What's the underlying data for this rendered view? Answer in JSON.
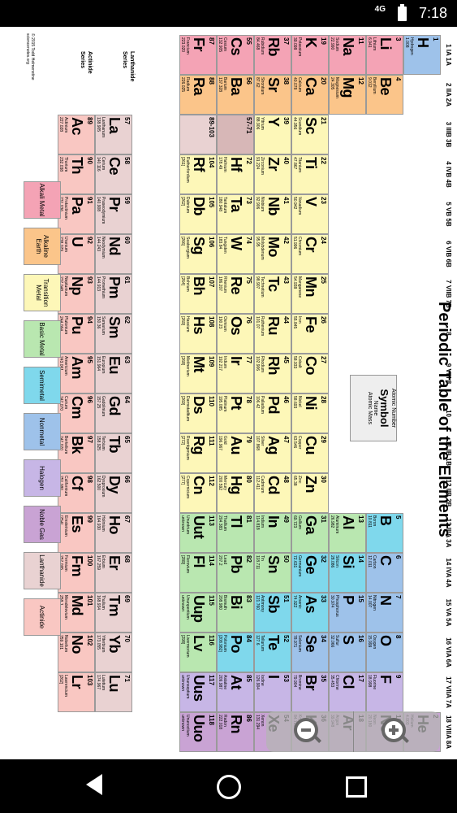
{
  "status": {
    "network": "4G",
    "time": "7:18"
  },
  "title": "Periodic Table of the Elements",
  "legend": {
    "atomic_number": "Atomic Number",
    "symbol": "Symbol",
    "name": "Name",
    "mass": "Atomic  Mass"
  },
  "series": {
    "lanthanide": "Lanthanide Series",
    "actinide": "Actinide Series"
  },
  "placeholders": {
    "la": "57-71",
    "ac": "89-103"
  },
  "copyright": "© 2015 Todd Helmenstine sciencenotes.org",
  "colors": {
    "alkali": "#f4a3b5",
    "alkaline": "#fbc58a",
    "transition": "#fdf7b8",
    "basic": "#b9e7b0",
    "semimetal": "#7fd8ec",
    "nonmetal": "#9ec2ea",
    "halogen": "#c7b6e6",
    "noble": "#c9a3d4",
    "lanthanide": "#e9d2d2",
    "actinide": "#f9c7c2",
    "placeholder": "#d7b7b7"
  },
  "key": [
    "Alkali Metal",
    "Alkaline Earth",
    "Transition Metal",
    "Basic Metal",
    "Semimetal",
    "Nonmetal",
    "Halogen",
    "Noble Gas",
    "Lanthanide",
    "Actinide"
  ],
  "groups": [
    "1 IA 1A",
    "2 IIA 2A",
    "3 IIIB 3B",
    "4 IVB 4B",
    "5 VB 5B",
    "6 VIB 6B",
    "7 VIIB 7B",
    "8",
    "9 VIII 8",
    "10",
    "11 IB 1B",
    "12 IIB 2B",
    "13 IIIA 3A",
    "14 IVA 4A",
    "15 VA 5A",
    "16 VIA 6A",
    "17 VIIA 7A",
    "18 VIIIA 8A"
  ],
  "elements": [
    [
      "1",
      "H",
      "Hydrogen",
      "1.008",
      0,
      0,
      "nonmetal"
    ],
    [
      "2",
      "He",
      "Helium",
      "4.003",
      0,
      17,
      "noble"
    ],
    [
      "3",
      "Li",
      "Lithium",
      "6.941",
      1,
      0,
      "alkali"
    ],
    [
      "4",
      "Be",
      "Beryllium",
      "9.012",
      1,
      1,
      "alkaline"
    ],
    [
      "5",
      "B",
      "Boron",
      "10.811",
      1,
      12,
      "semimetal"
    ],
    [
      "6",
      "C",
      "Carbon",
      "12.011",
      1,
      13,
      "nonmetal"
    ],
    [
      "7",
      "N",
      "Nitrogen",
      "14.007",
      1,
      14,
      "nonmetal"
    ],
    [
      "8",
      "O",
      "Oxygen",
      "15.999",
      1,
      15,
      "nonmetal"
    ],
    [
      "9",
      "F",
      "Fluorine",
      "18.998",
      1,
      16,
      "halogen"
    ],
    [
      "10",
      "Ne",
      "Neon",
      "20.180",
      1,
      17,
      "noble"
    ],
    [
      "11",
      "Na",
      "Sodium",
      "22.990",
      2,
      0,
      "alkali"
    ],
    [
      "12",
      "Mg",
      "Magnesium",
      "24.305",
      2,
      1,
      "alkaline"
    ],
    [
      "13",
      "Al",
      "Aluminum",
      "26.982",
      2,
      12,
      "basic"
    ],
    [
      "14",
      "Si",
      "Silicon",
      "28.086",
      2,
      13,
      "semimetal"
    ],
    [
      "15",
      "P",
      "Phosphorus",
      "30.974",
      2,
      14,
      "nonmetal"
    ],
    [
      "16",
      "S",
      "Sulfur",
      "32.066",
      2,
      15,
      "nonmetal"
    ],
    [
      "17",
      "Cl",
      "Chlorine",
      "35.453",
      2,
      16,
      "halogen"
    ],
    [
      "18",
      "Ar",
      "Argon",
      "39.948",
      2,
      17,
      "noble"
    ],
    [
      "19",
      "K",
      "Potassium",
      "39.098",
      3,
      0,
      "alkali"
    ],
    [
      "20",
      "Ca",
      "Calcium",
      "40.078",
      3,
      1,
      "alkaline"
    ],
    [
      "21",
      "Sc",
      "Scandium",
      "44.956",
      3,
      2,
      "transition"
    ],
    [
      "22",
      "Ti",
      "Titanium",
      "47.867",
      3,
      3,
      "transition"
    ],
    [
      "23",
      "V",
      "Vanadium",
      "50.942",
      3,
      4,
      "transition"
    ],
    [
      "24",
      "Cr",
      "Chromium",
      "51.996",
      3,
      5,
      "transition"
    ],
    [
      "25",
      "Mn",
      "Manganese",
      "54.938",
      3,
      6,
      "transition"
    ],
    [
      "26",
      "Fe",
      "Iron",
      "55.845",
      3,
      7,
      "transition"
    ],
    [
      "27",
      "Co",
      "Cobalt",
      "58.933",
      3,
      8,
      "transition"
    ],
    [
      "28",
      "Ni",
      "Nickel",
      "58.693",
      3,
      9,
      "transition"
    ],
    [
      "29",
      "Cu",
      "Copper",
      "63.546",
      3,
      10,
      "transition"
    ],
    [
      "30",
      "Zn",
      "Zinc",
      "65.38",
      3,
      11,
      "transition"
    ],
    [
      "31",
      "Ga",
      "Gallium",
      "69.723",
      3,
      12,
      "basic"
    ],
    [
      "32",
      "Ge",
      "Germanium",
      "72.631",
      3,
      13,
      "semimetal"
    ],
    [
      "33",
      "As",
      "Arsenic",
      "74.922",
      3,
      14,
      "semimetal"
    ],
    [
      "34",
      "Se",
      "Selenium",
      "78.971",
      3,
      15,
      "nonmetal"
    ],
    [
      "35",
      "Br",
      "Bromine",
      "79.904",
      3,
      16,
      "halogen"
    ],
    [
      "36",
      "Kr",
      "Krypton",
      "84.798",
      3,
      17,
      "noble"
    ],
    [
      "37",
      "Rb",
      "Rubidium",
      "84.468",
      4,
      0,
      "alkali"
    ],
    [
      "38",
      "Sr",
      "Strontium",
      "87.62",
      4,
      1,
      "alkaline"
    ],
    [
      "39",
      "Y",
      "Yttrium",
      "88.906",
      4,
      2,
      "transition"
    ],
    [
      "40",
      "Zr",
      "Zirconium",
      "91.224",
      4,
      3,
      "transition"
    ],
    [
      "41",
      "Nb",
      "Niobium",
      "92.906",
      4,
      4,
      "transition"
    ],
    [
      "42",
      "Mo",
      "Molybdenum",
      "95.95",
      4,
      5,
      "transition"
    ],
    [
      "43",
      "Tc",
      "Technetium",
      "98.907",
      4,
      6,
      "transition"
    ],
    [
      "44",
      "Ru",
      "Ruthenium",
      "101.07",
      4,
      7,
      "transition"
    ],
    [
      "45",
      "Rh",
      "Rhodium",
      "102.906",
      4,
      8,
      "transition"
    ],
    [
      "46",
      "Pd",
      "Palladium",
      "106.42",
      4,
      9,
      "transition"
    ],
    [
      "47",
      "Ag",
      "Silver",
      "107.868",
      4,
      10,
      "transition"
    ],
    [
      "48",
      "Cd",
      "Cadmium",
      "112.411",
      4,
      11,
      "transition"
    ],
    [
      "49",
      "In",
      "Indium",
      "114.818",
      4,
      12,
      "basic"
    ],
    [
      "50",
      "Sn",
      "Tin",
      "118.711",
      4,
      13,
      "basic"
    ],
    [
      "51",
      "Sb",
      "Antimony",
      "121.760",
      4,
      14,
      "semimetal"
    ],
    [
      "52",
      "Te",
      "Tellurium",
      "127.6",
      4,
      15,
      "semimetal"
    ],
    [
      "53",
      "I",
      "Iodine",
      "126.904",
      4,
      16,
      "halogen"
    ],
    [
      "54",
      "Xe",
      "Xenon",
      "131.294",
      4,
      17,
      "noble"
    ],
    [
      "55",
      "Cs",
      "Cesium",
      "132.905",
      5,
      0,
      "alkali"
    ],
    [
      "56",
      "Ba",
      "Barium",
      "137.328",
      5,
      1,
      "alkaline"
    ],
    [
      "72",
      "Hf",
      "Hafnium",
      "178.49",
      5,
      3,
      "transition"
    ],
    [
      "73",
      "Ta",
      "Tantalum",
      "180.948",
      5,
      4,
      "transition"
    ],
    [
      "74",
      "W",
      "Tungsten",
      "183.84",
      5,
      5,
      "transition"
    ],
    [
      "75",
      "Re",
      "Rhenium",
      "186.207",
      5,
      6,
      "transition"
    ],
    [
      "76",
      "Os",
      "Osmium",
      "190.23",
      5,
      7,
      "transition"
    ],
    [
      "77",
      "Ir",
      "Iridium",
      "192.217",
      5,
      8,
      "transition"
    ],
    [
      "78",
      "Pt",
      "Platinum",
      "195.085",
      5,
      9,
      "transition"
    ],
    [
      "79",
      "Au",
      "Gold",
      "196.967",
      5,
      10,
      "transition"
    ],
    [
      "80",
      "Hg",
      "Mercury",
      "200.592",
      5,
      11,
      "transition"
    ],
    [
      "81",
      "Tl",
      "Thallium",
      "204.383",
      5,
      12,
      "basic"
    ],
    [
      "82",
      "Pb",
      "Lead",
      "207.2",
      5,
      13,
      "basic"
    ],
    [
      "83",
      "Bi",
      "Bismuth",
      "208.980",
      5,
      14,
      "basic"
    ],
    [
      "84",
      "Po",
      "Polonium",
      "[208.982]",
      5,
      15,
      "semimetal"
    ],
    [
      "85",
      "At",
      "Astatine",
      "209.987",
      5,
      16,
      "halogen"
    ],
    [
      "86",
      "Rn",
      "Radon",
      "222.018",
      5,
      17,
      "noble"
    ],
    [
      "87",
      "Fr",
      "Francium",
      "223.020",
      6,
      0,
      "alkali"
    ],
    [
      "88",
      "Ra",
      "Radium",
      "226.025",
      6,
      1,
      "alkaline"
    ],
    [
      "104",
      "Rf",
      "Rutherfordium",
      "[261]",
      6,
      3,
      "transition"
    ],
    [
      "105",
      "Db",
      "Dubnium",
      "[262]",
      6,
      4,
      "transition"
    ],
    [
      "106",
      "Sg",
      "Seaborgium",
      "[266]",
      6,
      5,
      "transition"
    ],
    [
      "107",
      "Bh",
      "Bohrium",
      "[264]",
      6,
      6,
      "transition"
    ],
    [
      "108",
      "Hs",
      "Hassium",
      "[269]",
      6,
      7,
      "transition"
    ],
    [
      "109",
      "Mt",
      "Meitnerium",
      "[268]",
      6,
      8,
      "transition"
    ],
    [
      "110",
      "Ds",
      "Darmstadtium",
      "[269]",
      6,
      9,
      "transition"
    ],
    [
      "111",
      "Rg",
      "Roentgenium",
      "[272]",
      6,
      10,
      "transition"
    ],
    [
      "112",
      "Cn",
      "Copernicium",
      "[277]",
      6,
      11,
      "transition"
    ],
    [
      "113",
      "Uut",
      "Ununtrium",
      "unknown",
      6,
      12,
      "basic"
    ],
    [
      "114",
      "Fl",
      "Flerovium",
      "[289]",
      6,
      13,
      "basic"
    ],
    [
      "115",
      "Uup",
      "Ununpentium",
      "unknown",
      6,
      14,
      "basic"
    ],
    [
      "116",
      "Lv",
      "Livermorium",
      "[298]",
      6,
      15,
      "basic"
    ],
    [
      "117",
      "Uus",
      "Ununseptium",
      "unknown",
      6,
      16,
      "halogen"
    ],
    [
      "118",
      "Uuo",
      "Ununoctium",
      "unknown",
      6,
      17,
      "noble"
    ],
    [
      "57",
      "La",
      "Lanthanum",
      "138.905",
      8,
      2,
      "lanthanide"
    ],
    [
      "58",
      "Ce",
      "Cerium",
      "140.116",
      8,
      3,
      "lanthanide"
    ],
    [
      "59",
      "Pr",
      "Praseodymium",
      "140.908",
      8,
      4,
      "lanthanide"
    ],
    [
      "60",
      "Nd",
      "Neodymium",
      "144.243",
      8,
      5,
      "lanthanide"
    ],
    [
      "61",
      "Pm",
      "Promethium",
      "144.913",
      8,
      6,
      "lanthanide"
    ],
    [
      "62",
      "Sm",
      "Samarium",
      "150.36",
      8,
      7,
      "lanthanide"
    ],
    [
      "63",
      "Eu",
      "Europium",
      "151.964",
      8,
      8,
      "lanthanide"
    ],
    [
      "64",
      "Gd",
      "Gadolinium",
      "157.25",
      8,
      9,
      "lanthanide"
    ],
    [
      "65",
      "Tb",
      "Terbium",
      "158.925",
      8,
      10,
      "lanthanide"
    ],
    [
      "66",
      "Dy",
      "Dysprosium",
      "162.500",
      8,
      11,
      "lanthanide"
    ],
    [
      "67",
      "Ho",
      "Holmium",
      "164.930",
      8,
      12,
      "lanthanide"
    ],
    [
      "68",
      "Er",
      "Erbium",
      "167.259",
      8,
      13,
      "lanthanide"
    ],
    [
      "69",
      "Tm",
      "Thulium",
      "168.934",
      8,
      14,
      "lanthanide"
    ],
    [
      "70",
      "Yb",
      "Ytterbium",
      "173.055",
      8,
      15,
      "lanthanide"
    ],
    [
      "71",
      "Lu",
      "Lutetium",
      "174.967",
      8,
      16,
      "lanthanide"
    ],
    [
      "89",
      "Ac",
      "Actinium",
      "227.028",
      9,
      2,
      "actinide"
    ],
    [
      "90",
      "Th",
      "Thorium",
      "232.038",
      9,
      3,
      "actinide"
    ],
    [
      "91",
      "Pa",
      "Protactinium",
      "231.036",
      9,
      4,
      "actinide"
    ],
    [
      "92",
      "U",
      "Uranium",
      "238.029",
      9,
      5,
      "actinide"
    ],
    [
      "93",
      "Np",
      "Neptunium",
      "237.048",
      9,
      6,
      "actinide"
    ],
    [
      "94",
      "Pu",
      "Plutonium",
      "244.064",
      9,
      7,
      "actinide"
    ],
    [
      "95",
      "Am",
      "Americium",
      "243.061",
      9,
      8,
      "actinide"
    ],
    [
      "96",
      "Cm",
      "Curium",
      "247.070",
      9,
      9,
      "actinide"
    ],
    [
      "97",
      "Bk",
      "Berkelium",
      "247.070",
      9,
      10,
      "actinide"
    ],
    [
      "98",
      "Cf",
      "Californium",
      "251.080",
      9,
      11,
      "actinide"
    ],
    [
      "99",
      "Es",
      "Einsteinium",
      "[254]",
      9,
      12,
      "actinide"
    ],
    [
      "100",
      "Fm",
      "Fermium",
      "257.095",
      9,
      13,
      "actinide"
    ],
    [
      "101",
      "Md",
      "Mendelevium",
      "258.1",
      9,
      14,
      "actinide"
    ],
    [
      "102",
      "No",
      "Nobelium",
      "259.101",
      9,
      15,
      "actinide"
    ],
    [
      "103",
      "Lr",
      "Lawrencium",
      "[262]",
      9,
      16,
      "actinide"
    ]
  ]
}
